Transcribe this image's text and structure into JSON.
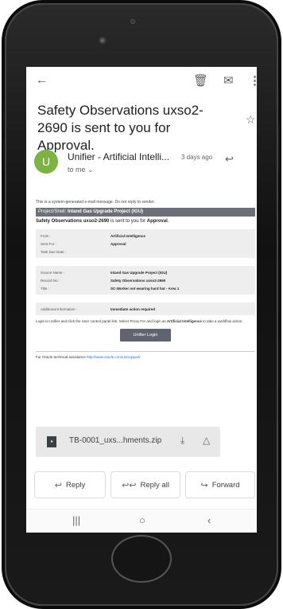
{
  "email": {
    "subject": "Safety Observations uxso2-2690 is sent to you for Approval.",
    "sender_initial": "U",
    "sender_name": "Unifier - Artificial Intelli...",
    "time": "3 days ago",
    "to_me": "to me ⌄"
  },
  "body": {
    "auto_msg": "This is a system-generated e-mail message. Do not reply to sender.",
    "project_label": "Project/Shell:",
    "project_value": "Inland Gas Upgrade Project (IGU)",
    "approval_strong1": "Safety Observations uxso2-2690",
    "approval_text": " is sent to you for ",
    "approval_strong2": "Approval",
    "approval_end": ".",
    "panel1": [
      {
        "label": "From :",
        "value": "Artificial Intelligence"
      },
      {
        "label": "Sent For :",
        "value": "Approval"
      },
      {
        "label": "Task Due Date :",
        "value": ""
      }
    ],
    "panel2": [
      {
        "label": "Source Name :",
        "value": "Inland Gas Upgrade Project (IGU)"
      },
      {
        "label": "Record No :",
        "value": "Safety Observations uxso2-2690"
      },
      {
        "label": "Title :",
        "value": "SC-Worker not wearing hard hat - Area 1"
      }
    ],
    "panel3": [
      {
        "label": "Additional Information :",
        "value": "Immediate action required"
      }
    ],
    "login_text_a": "Login to Unifier and click the User control panel link. Select Proxy For and login as ",
    "login_text_b": "Artificial Intelligence",
    "login_text_c": " to take a workflow action.",
    "login_button": "Unifier Login",
    "support_text": "For Oracle technical assistance ",
    "support_link": "http://www.oracle.com/us/support/"
  },
  "attachment": {
    "name": "TB-0001_uxs...hments.zip"
  },
  "actions": {
    "reply": "Reply",
    "reply_all": "Reply all",
    "forward": "Forward"
  },
  "icons": {
    "back": "←",
    "trash": "🗑",
    "mail": "✉",
    "more": "⋮",
    "star": "☆",
    "reply": "↩",
    "reply_all": "↩↩",
    "forward": "↪",
    "download": "⤓",
    "drive": "△",
    "nav_recent": "|||",
    "nav_home": "○",
    "nav_back": "‹"
  }
}
